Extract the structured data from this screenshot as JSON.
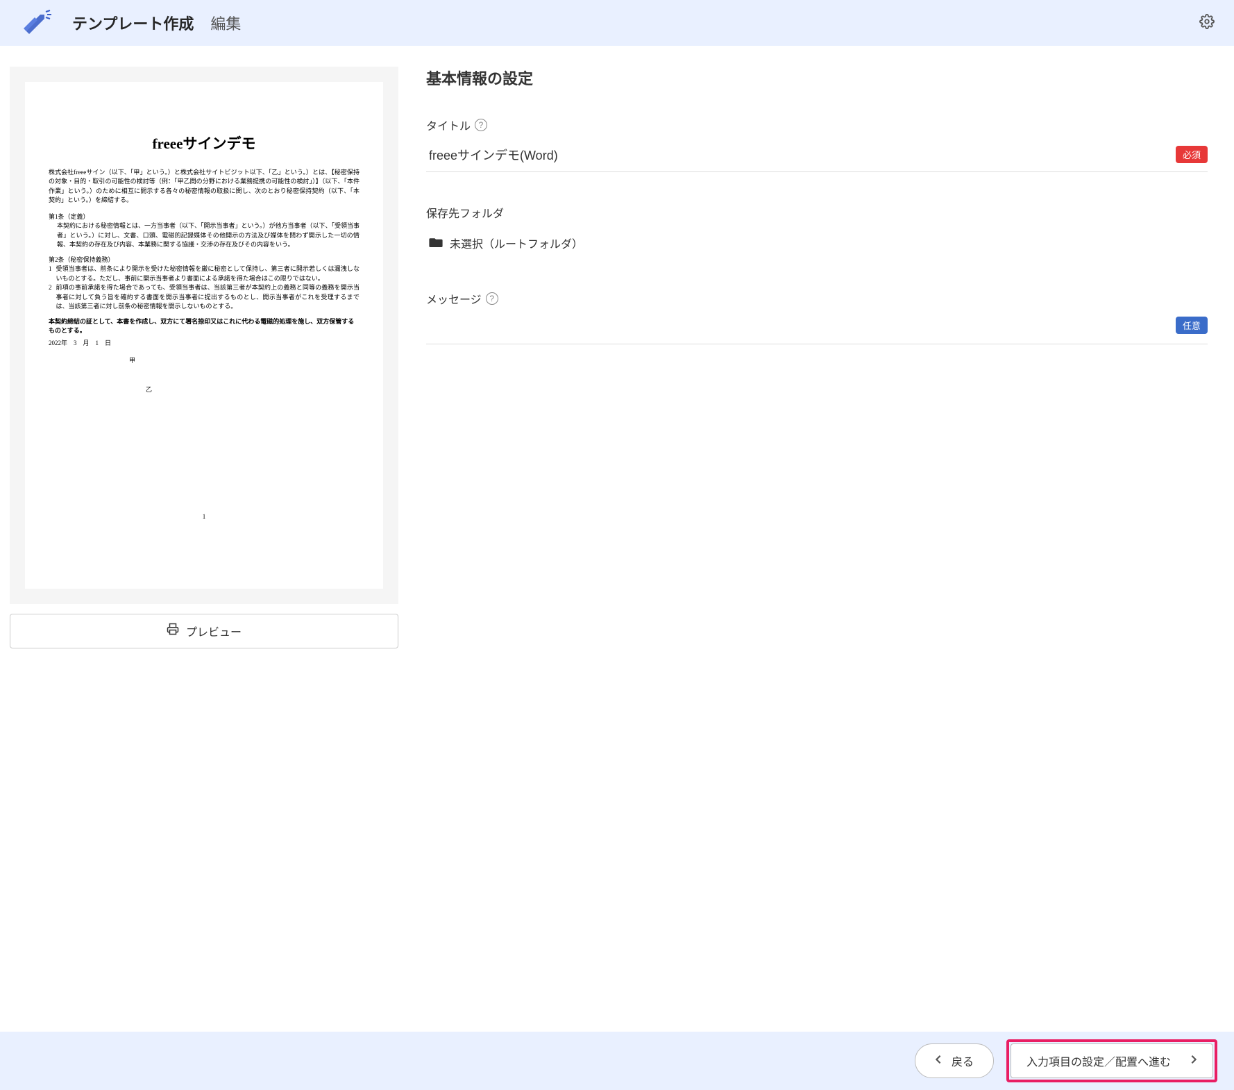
{
  "header": {
    "title": "テンプレート作成",
    "subtitle": "編集"
  },
  "document": {
    "title": "freeeサインデモ",
    "intro": "株式会社freeeサイン（以下、「甲」という。）と株式会社サイトビジット以下、「乙」という。）とは、【秘密保持の対象・目的・取引の可能性の検討等（例：「甲乙間の分野における業務提携の可能性の検討」）】（以下、「本件作業」という。）のために相互に開示する各々の秘密情報の取扱に関し、次のとおり秘密保持契約（以下、「本契約」という。）を締結する。",
    "article1_header": "第1条（定義）",
    "article1_body": "本契約における秘密情報とは、一方当事者（以下、「開示当事者」という。）が他方当事者（以下、「受領当事者」という。）に対し、文書、口頭、電磁的記録媒体その他開示の方法及び媒体を問わず開示した一切の情報、本契約の存在及び内容、本業務に関する協議・交渉の存在及びその内容をいう。",
    "article2_header": "第2条（秘密保持義務）",
    "article2_item1_num": "1",
    "article2_item1": "受領当事者は、前条により開示を受けた秘密情報を厳に秘密として保持し、第三者に開示若しくは漏洩しないものとする。ただし、事前に開示当事者より書面による承諾を得た場合はこの限りではない。",
    "article2_item2_num": "2",
    "article2_item2": "前項の事前承諾を得た場合であっても、受領当事者は、当該第三者が本契約上の義務と同等の義務を開示当事者に対して負う旨を確約する書面を開示当事者に提出するものとし、開示当事者がこれを受理するまでは、当該第三者に対し前条の秘密情報を開示しないものとする。",
    "closing": "本契約締結の証として、本書を作成し、双方にて署名捺印又はこれに代わる電磁的処理を施し、双方保管するものとする。",
    "date": "2022年　3　月　1　日",
    "party1": "甲",
    "party2": "乙",
    "page_num": "1"
  },
  "preview_button": "プレビュー",
  "form": {
    "section_title": "基本情報の設定",
    "title_label": "タイトル",
    "title_value": "freeeサインデモ(Word)",
    "required_badge": "必須",
    "folder_label": "保存先フォルダ",
    "folder_value": "未選択（ルートフォルダ）",
    "message_label": "メッセージ",
    "optional_badge": "任意"
  },
  "footer": {
    "back_label": "戻る",
    "next_label": "入力項目の設定／配置へ進む"
  }
}
